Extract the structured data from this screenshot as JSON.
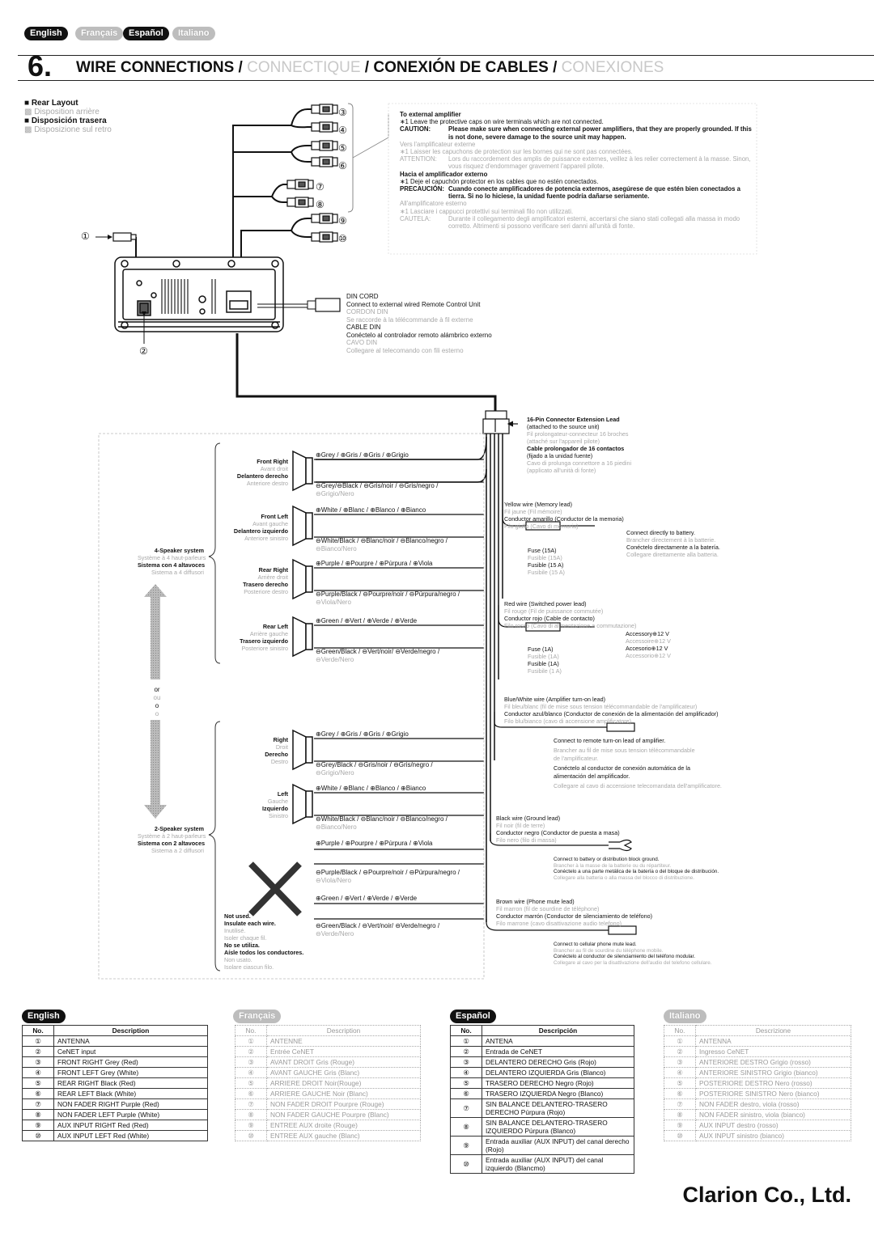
{
  "language_tabs": [
    {
      "label": "English",
      "active": true
    },
    {
      "label": "Français",
      "active": false
    },
    {
      "label": "Español",
      "active": true
    },
    {
      "label": "Italiano",
      "active": false
    }
  ],
  "section": {
    "number": "6.",
    "title_en": "WIRE CONNECTIONS /",
    "title_fr": "CONNECTIQUE",
    "title_sep": " /",
    "title_es": "CONEXIÓN DE CABLES /",
    "title_it": "CONEXIONES"
  },
  "rear_layout": {
    "en": "Rear Layout",
    "fr": "Disposition arrière",
    "es": "Disposición trasera",
    "it": "Disposizione sul retro"
  },
  "connector_numbers": [
    "①",
    "②",
    "③",
    "④",
    "⑤",
    "⑥",
    "⑦",
    "⑧",
    "⑨",
    "⑩"
  ],
  "amp_note": {
    "en_title": "To external amplifier",
    "en_note": "∗1  Leave the protective caps on wire terminals which are not connected.",
    "en_caution_label": "CAUTION:",
    "en_caution": "Please make sure when connecting external power amplifiers, that they are properly grounded. If this is not done, severe damage to the source unit may happen.",
    "fr_title": "Vers l'amplificateur externe",
    "fr_note": "∗1  Laisser les capuchons de protection sur les bornes qui ne sont pas connectées.",
    "fr_caution_label": "ATTENTION:",
    "fr_caution": "Lors du raccordement des amplis de puissance externes, veillez à les relier correctement à la masse. Sinon, vous risquez d'endommager gravement l'appareil pilote.",
    "es_title": "Hacia el amplificador externo",
    "es_note": "∗1  Deje el capuchón protector en los cables que no estén conectados.",
    "es_caution_label": "PRECAUCIÓN:",
    "es_caution": "Cuando conecte amplificadores de potencia externos, asegúrese de que estén bien conectados a tierra. Si no lo hiciese, la unidad fuente podría dañarse seriamente.",
    "it_title": "All'amplificatore esterno",
    "it_note": "∗1  Lasciare i cappucci protettivi sui terminali filo non utilizzati.",
    "it_caution_label": "CAUTELA:",
    "it_caution": "Durante il collegamento degli amplificatori esterni, accertarsi che siano stati collegati alla massa in modo corretto. Altrimenti si possono verificare seri danni all'unità di fonte."
  },
  "din_cord": {
    "en_title": "DIN CORD",
    "en_desc": "Connect to external wired Remote Control Unit",
    "fr_title": "CORDON DIN",
    "fr_desc": "Se raccorde à la télécommande à fil externe",
    "es_title": "CABLE DIN",
    "es_desc": "Conéctelo al controlador remoto alámbrico externo",
    "it_title": "CAVO DIN",
    "it_desc": "Collegare al telecomando con fili esterno"
  },
  "extension_lead": {
    "en_title": "16-Pin Connector Extension Lead",
    "en_sub": "(attached to the source unit)",
    "fr_title": "Fil prolongateur-connecteur 16 broches",
    "fr_sub": "(attaché sur l'appareil pilote)",
    "es_title": "Cable prolongador de 16 contactos",
    "es_sub": "(fijado a la unidad fuente)",
    "it_title": "Cavo di prolunga connettore a 16 piedini",
    "it_sub": "(applicato all'unità di fonte)"
  },
  "speaker_4": {
    "label_en": "4-Speaker system",
    "label_fr": "Système à 4 haut-parleurs",
    "label_es": "Sistema con 4 altavoces",
    "label_it": "Sistema a 4 diffusori",
    "speakers": [
      {
        "en": "Front Right",
        "fr": "Avant droit",
        "es": "Delantero derecho",
        "it": "Anteriore destro",
        "plus": "⊕Grey / ⊕Gris / ⊕Gris / ⊕Grigio",
        "minus": "⊖Grey/⊖Black / ⊖Gris/noir / ⊖Gris/negro /",
        "minus2": "⊖Grigio/Nero"
      },
      {
        "en": "Front Left",
        "fr": "Avant gauche",
        "es": "Delantero izquierdo",
        "it": "Anteriore sinistro",
        "plus": "⊕White / ⊕Blanc / ⊕Blanco / ⊕Bianco",
        "minus": "⊖White/Black / ⊖Blanc/noir / ⊖Blanco/negro /",
        "minus2": "⊖Bianco/Nero"
      },
      {
        "en": "Rear Right",
        "fr": "Arrière droit",
        "es": "Trasero derecho",
        "it": "Posteriore destro",
        "plus": "⊕Purple / ⊕Pourpre / ⊕Púrpura / ⊕Viola",
        "minus": "⊖Purple/Black / ⊖Pourpre/noir / ⊖Púrpura/negro /",
        "minus2": "⊖Viola/Nero"
      },
      {
        "en": "Rear Left",
        "fr": "Arrière gauche",
        "es": "Trasero izquierdo",
        "it": "Posteriore sinistro",
        "plus": "⊕Green / ⊕Vert / ⊕Verde / ⊕Verde",
        "minus": "⊖Green/Black / ⊖Vert/noir/ ⊖Verde/negro /",
        "minus2": "⊖Verde/Nero"
      }
    ]
  },
  "or_words": [
    "or",
    "ou",
    "o",
    "o"
  ],
  "speaker_2": {
    "label_en": "2-Speaker system",
    "label_fr": "Système à 2 haut-parleurs",
    "label_es": "Sistema con 2 altavoces",
    "label_it": "Sistema a 2 diffusori",
    "speakers": [
      {
        "en": "Right",
        "fr": "Droit",
        "es": "Derecho",
        "it": "Destro",
        "plus": "⊕Grey / ⊕Gris / ⊕Gris / ⊕Grigio",
        "minus": "⊖Grey/Black / ⊖Gris/noir / ⊖Gris/negro /",
        "minus2": "⊖Grigio/Nero"
      },
      {
        "en": "Left",
        "fr": "Gauche",
        "es": "Izquierdo",
        "it": "Sinistro",
        "plus": "⊕White / ⊕Blanc / ⊕Blanco / ⊕Bianco",
        "minus": "⊖White/Black / ⊖Blanc/noir / ⊖Blanco/negro /",
        "minus2": "⊖Bianco/Nero"
      }
    ],
    "unused_wires": [
      {
        "text": "⊕Purple / ⊕Pourpre / ⊕Púrpura / ⊕Viola"
      },
      {
        "text": "⊖Purple/Black / ⊖Pourpre/noir / ⊖Púrpura/negro /",
        "text2": "⊖Viola/Nero"
      },
      {
        "text": "⊕Green / ⊕Vert / ⊕Verde / ⊕Verde"
      },
      {
        "text": "⊖Green/Black / ⊖Vert/noir/ ⊖Verde/negro /",
        "text2": "⊖Verde/Nero"
      }
    ],
    "not_used": {
      "en1": "Not used.",
      "en2": "Insulate each wire.",
      "fr1": "Inutilisé.",
      "fr2": "Isoler chaque fil.",
      "es1": "No se utiliza.",
      "es2": "Aísle todos los conductores.",
      "it1": "Non usato.",
      "it2": "Isolare ciascun filo."
    }
  },
  "wires": {
    "yellow": {
      "en": "Yellow wire (Memory lead)",
      "fr": "Fil jaune (Fil mémoire)",
      "es": "Conductor amarillo (Conductor de la memoria)",
      "it": "Filo giallo (Cavo di memoria)",
      "fuse_en": "Fuse (15A)",
      "fuse_fr": "Fusible (15A)",
      "fuse_es": "Fusible (15 A)",
      "fuse_it": "Fusibile (15 A)",
      "conn_en": "Connect directly to battery.",
      "conn_fr": "Brancher directement à la batterie.",
      "conn_es": "Conéctelo directamente a la batería.",
      "conn_it": "Collegare direttamente alla batteria."
    },
    "red": {
      "en": "Red wire (Switched power lead)",
      "fr": "Fil rouge (Fil de puissance commutée)",
      "es": "Conductor rojo (Cable de contacto)",
      "it": "Filo rosso (Cavo di alimentazione a commutazione)",
      "fuse_en": "Fuse (1A)",
      "fuse_fr": "Fusible (1A)",
      "fuse_es": "Fusible (1A)",
      "fuse_it": "Fusibile (1 A)",
      "conn_en": "Accessory⊕12 V",
      "conn_fr": "Accessoire⊕12 V",
      "conn_es": "Accesorio⊕12 V",
      "conn_it": "Accessorio⊕12 V"
    },
    "blue": {
      "en": "Blue/White wire (Amplifier turn-on lead)",
      "fr": "Fil bleu/blanc (fil de mise sous tension télécommandable de l'amplificateur)",
      "es": "Conductor azul/blanco (Conductor de conexión de la alimentación del amplificador)",
      "it": "Filo blu/bianco (cavo di accensione amplificatore)",
      "conn_en": "Connect to remote turn-on lead of amplifier.",
      "conn_fr": "Brancher au fil de mise sous tension télécommandable",
      "conn_fr2": "de l'amplificateur.",
      "conn_es": "Conéctelo al conductor de conexión automática de la",
      "conn_es2": "alimentación del amplificador.",
      "conn_it": "Collegare al cavo di accensione telecomandata dell'amplificatore."
    },
    "black": {
      "en": "Black wire (Ground lead)",
      "fr": "Fil noir (fil de terre)",
      "es": "Conductor negro (Conductor de puesta a masa)",
      "it": "Filo nero (filo di massa)",
      "conn_en": "Connect to battery or distribution block ground.",
      "conn_fr": "Brancher à la masse de la batterie ou du répartiteur.",
      "conn_es": "Conéctelo a una parte metálica de la batería o del bloque de distribución.",
      "conn_it": "Collegare alla batteria o alla massa del blocco di distribuzione."
    },
    "brown": {
      "en": "Brown wire (Phone mute lead)",
      "fr": "Fil marron (fil de sourdine de téléphone)",
      "es": "Conductor marrón (Conductor de silenciamiento de teléfono)",
      "it": "Filo marrone (cavo disattivazione audio telefono)",
      "conn_en": "Connect to cellular phone mute lead.",
      "conn_fr": "Brancher au fil de sourdine du téléphone mobile.",
      "conn_es": "Conéctelo al conductor de silenciamiento del teléfono modular.",
      "conn_it": "Collegare al cavo per la disattivazione dell'audio del telefono cellulare."
    }
  },
  "tables": [
    {
      "lang": "English",
      "col_no": "No.",
      "col_desc": "Description",
      "rows": [
        [
          "①",
          "ANTENNA"
        ],
        [
          "②",
          "CeNET input"
        ],
        [
          "③",
          "FRONT RIGHT Grey (Red)"
        ],
        [
          "④",
          "FRONT LEFT Grey (White)"
        ],
        [
          "⑤",
          "REAR RIGHT Black (Red)"
        ],
        [
          "⑥",
          "REAR LEFT Black (White)"
        ],
        [
          "⑦",
          "NON FADER RIGHT Purple (Red)"
        ],
        [
          "⑧",
          "NON FADER LEFT Purple (White)"
        ],
        [
          "⑨",
          "AUX INPUT RIGHT Red (Red)"
        ],
        [
          "⑩",
          "AUX INPUT LEFT Red (White)"
        ]
      ]
    },
    {
      "lang": "Français",
      "col_no": "No.",
      "col_desc": "Description",
      "rows": [
        [
          "①",
          "ANTENNE"
        ],
        [
          "②",
          "Entrée CeNET"
        ],
        [
          "③",
          "AVANT DROIT Gris (Rouge)"
        ],
        [
          "④",
          "AVANT GAUCHE Gris (Blanc)"
        ],
        [
          "⑤",
          "ARRIERE DROIT Noir(Rouge)"
        ],
        [
          "⑥",
          "ARRIERE GAUCHE Noir (Blanc)"
        ],
        [
          "⑦",
          "NON FADER  DROIT Pourpre (Rouge)"
        ],
        [
          "⑧",
          "NON FADER  GAUCHE Pourpre (Blanc)"
        ],
        [
          "⑨",
          "ENTREE AUX droite (Rouge)"
        ],
        [
          "⑩",
          "ENTREE AUX gauche (Blanc)"
        ]
      ]
    },
    {
      "lang": "Español",
      "col_no": "No.",
      "col_desc": "Descripción",
      "rows": [
        [
          "①",
          "ANTENA"
        ],
        [
          "②",
          "Entrada de CeNET"
        ],
        [
          "③",
          "DELANTERO DERECHO Gris (Rojo)"
        ],
        [
          "④",
          "DELANTERO IZQUIERDA Gris (Blanco)"
        ],
        [
          "⑤",
          "TRASERO DERECHO Negro (Rojo)"
        ],
        [
          "⑥",
          "TRASERO IZQUIERDA Negro (Blanco)"
        ],
        [
          "⑦",
          "SIN BALANCE DELANTERO-TRASERO DERECHO Púrpura (Rojo)"
        ],
        [
          "⑧",
          "SIN BALANCE DELANTERO-TRASERO IZQUIERDO Púrpura (Blanco)"
        ],
        [
          "⑨",
          "Entrada auxiliar (AUX INPUT) del canal derecho (Rojo)"
        ],
        [
          "⑩",
          "Entrada auxiliar (AUX INPUT) del canal izquierdo (Blancmo)"
        ]
      ]
    },
    {
      "lang": "Italiano",
      "col_no": "No.",
      "col_desc": "Descrizione",
      "rows": [
        [
          "①",
          "ANTENNA"
        ],
        [
          "②",
          "Ingresso CeNET"
        ],
        [
          "③",
          "ANTERIORE DESTRO Grigio (rosso)"
        ],
        [
          "④",
          "ANTERIORE SINISTRO Grigio (bianco)"
        ],
        [
          "⑤",
          "POSTERIORE DESTRO Nero (rosso)"
        ],
        [
          "⑥",
          "POSTERIORE SINISTRO Nero (bianco)"
        ],
        [
          "⑦",
          "NON FADER destro, viola (rosso)"
        ],
        [
          "⑧",
          "NON FADER sinistro, viola (bianco)"
        ],
        [
          "⑨",
          "AUX INPUT destro (rosso)"
        ],
        [
          "⑩",
          "AUX INPUT sinistro (bianco)"
        ]
      ]
    }
  ],
  "company": "Clarion Co., Ltd."
}
